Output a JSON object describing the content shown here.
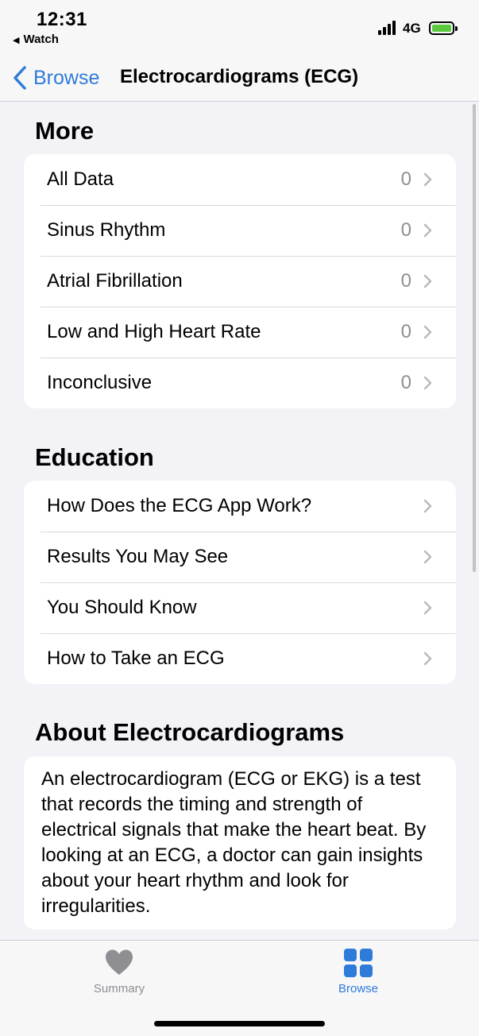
{
  "status_bar": {
    "time": "12:31",
    "back_app": "Watch",
    "network": "4G",
    "battery_charging": true
  },
  "nav": {
    "back_label": "Browse",
    "title": "Electrocardiograms (ECG)"
  },
  "more": {
    "header": "More",
    "items": [
      {
        "label": "All Data",
        "count": "0"
      },
      {
        "label": "Sinus Rhythm",
        "count": "0"
      },
      {
        "label": "Atrial Fibrillation",
        "count": "0"
      },
      {
        "label": "Low and High Heart Rate",
        "count": "0"
      },
      {
        "label": "Inconclusive",
        "count": "0"
      }
    ]
  },
  "education": {
    "header": "Education",
    "items": [
      {
        "label": "How Does the ECG App Work?"
      },
      {
        "label": "Results You May See"
      },
      {
        "label": "You Should Know"
      },
      {
        "label": "How to Take an ECG"
      }
    ]
  },
  "about": {
    "header": "About Electrocardiograms",
    "text": "An electrocardiogram (ECG or EKG) is a test that records the timing and strength of electrical signals that make the heart beat. By looking at an ECG, a doctor can gain insights about your heart rhythm and look for irregularities."
  },
  "tab_bar": {
    "tabs": [
      {
        "label": "Summary",
        "icon": "heart-icon",
        "selected": false
      },
      {
        "label": "Browse",
        "icon": "grid-icon",
        "selected": true
      }
    ]
  },
  "colors": {
    "accent": "#2f7bd9",
    "background": "#f2f2f7",
    "secondary_text": "#8e8e93"
  }
}
